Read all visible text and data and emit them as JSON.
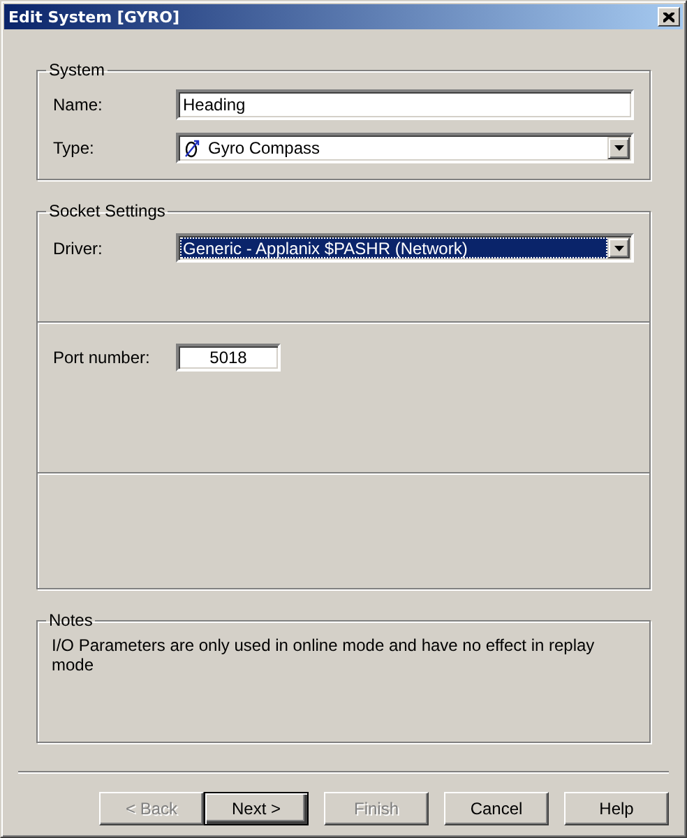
{
  "window": {
    "title": "Edit System [GYRO]"
  },
  "system": {
    "title": "System",
    "name": {
      "label": "Name:",
      "value": "Heading"
    },
    "type": {
      "label": "Type:",
      "value": "Gyro Compass"
    }
  },
  "socket_settings": {
    "title": "Socket Settings",
    "driver": {
      "label": "Driver:",
      "value": "Generic - Applanix $PASHR (Network)",
      "focused": true
    },
    "port": {
      "label": "Port number:",
      "value": "5018"
    }
  },
  "notes": {
    "title": "Notes",
    "text": "I/O Parameters are only used in online mode and have no effect in replay mode"
  },
  "buttons": [
    {
      "label": "< Back",
      "disabled": true,
      "default": false
    },
    {
      "label": "Next >",
      "disabled": false,
      "default": true
    },
    {
      "label": "Finish",
      "disabled": true,
      "default": false
    },
    {
      "label": "Cancel",
      "disabled": false,
      "default": false
    },
    {
      "label": "Help",
      "disabled": false,
      "default": false
    }
  ]
}
